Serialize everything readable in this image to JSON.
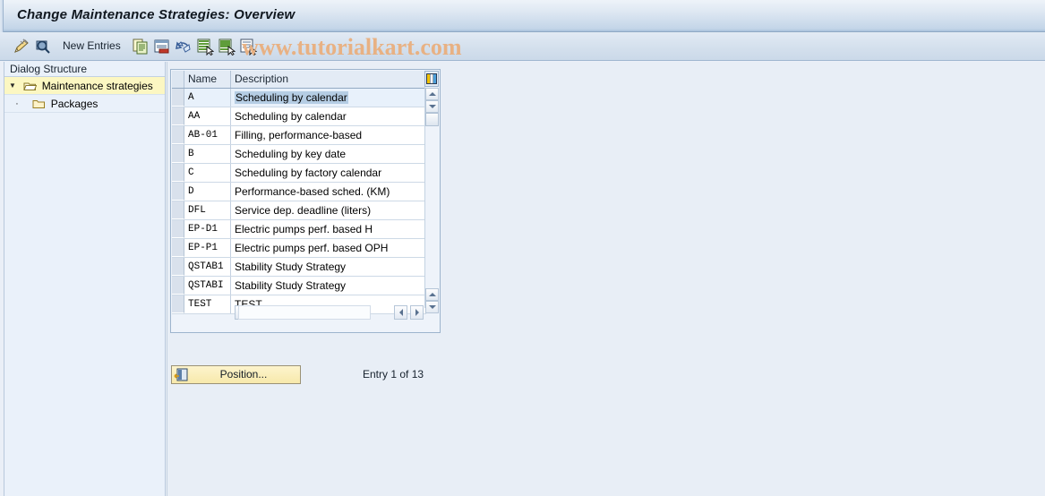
{
  "window": {
    "title": "Change Maintenance Strategies: Overview"
  },
  "watermark": {
    "text": "www.tutorialkart.com",
    "color": "#e8b183"
  },
  "toolbar": {
    "new_entries_label": "New Entries",
    "icons": [
      {
        "name": "change-display-pencil-icon",
        "title": "Display/Change"
      },
      {
        "name": "magnifier-display-icon",
        "title": "Display"
      },
      {
        "name": "copy-as-icon",
        "title": "Copy As..."
      },
      {
        "name": "delete-row-icon",
        "title": "Delete"
      },
      {
        "name": "undo-icon",
        "title": "Undo Change"
      },
      {
        "name": "select-all-icon",
        "title": "Select All"
      },
      {
        "name": "select-block-icon",
        "title": "Select Block"
      },
      {
        "name": "deselect-all-icon",
        "title": "Deselect All"
      }
    ]
  },
  "sidebar": {
    "header": "Dialog Structure",
    "items": [
      {
        "label": "Maintenance strategies",
        "selected": true,
        "level": 0,
        "expanded": true,
        "icon": "open-folder-icon"
      },
      {
        "label": "Packages",
        "selected": false,
        "level": 1,
        "expanded": false,
        "icon": "folder-icon"
      }
    ]
  },
  "table": {
    "columns": [
      "Name",
      "Description"
    ],
    "selected_row_index": 0,
    "highlight_text": "Scheduling by calendar",
    "rows": [
      {
        "name": "A",
        "description": "Scheduling by calendar"
      },
      {
        "name": "AA",
        "description": "Scheduling by calendar"
      },
      {
        "name": "AB-01",
        "description": "Filling, performance-based"
      },
      {
        "name": "B",
        "description": "Scheduling by key date"
      },
      {
        "name": "C",
        "description": "Scheduling by factory calendar"
      },
      {
        "name": "D",
        "description": "Performance-based sched. (KM)"
      },
      {
        "name": "DFL",
        "description": "Service dep. deadline (liters)"
      },
      {
        "name": "EP-D1",
        "description": "Electric pumps perf. based H"
      },
      {
        "name": "EP-P1",
        "description": "Electric pumps perf. based OPH"
      },
      {
        "name": "QSTAB1",
        "description": "Stability Study Strategy"
      },
      {
        "name": "QSTABI",
        "description": "Stability Study Strategy"
      },
      {
        "name": "TEST",
        "description": "TEST"
      }
    ]
  },
  "footer": {
    "position_button_label": "Position...",
    "entry_count_text": "Entry 1 of 13"
  }
}
